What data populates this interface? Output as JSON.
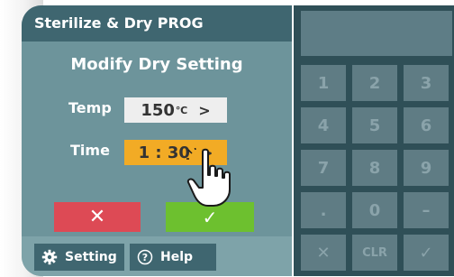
{
  "header": {
    "title": "Sterilize & Dry PROG"
  },
  "screen_title": "Modify Dry Setting",
  "temp": {
    "label": "Temp",
    "value": "150",
    "unit": "℃",
    "chevron": ">"
  },
  "time": {
    "label": "Time",
    "value": "1 : 30",
    "chevron": ">"
  },
  "actions": {
    "cancel": "✕",
    "confirm": "✓"
  },
  "bottom": {
    "setting": "Setting",
    "help": "Help"
  },
  "keypad": {
    "keys": [
      "1",
      "2",
      "3",
      "4",
      "5",
      "6",
      "7",
      "8",
      "9",
      ".",
      "0",
      "–",
      "✕",
      "CLR",
      "✓"
    ]
  },
  "colors": {
    "header_bar": "#3f6670",
    "screen_bg": "#6d949b",
    "temp_button": "#eeeeee",
    "time_button_selected": "#f2ab25",
    "cancel_button": "#dd4a55",
    "confirm_button": "#6dc02f",
    "keypad_bg": "#2f4f57",
    "keypad_key": "#5f7c84"
  },
  "icons": {
    "settings": "gear-icon",
    "help": "question-circle-icon",
    "pointer": "pointing-hand-icon"
  }
}
